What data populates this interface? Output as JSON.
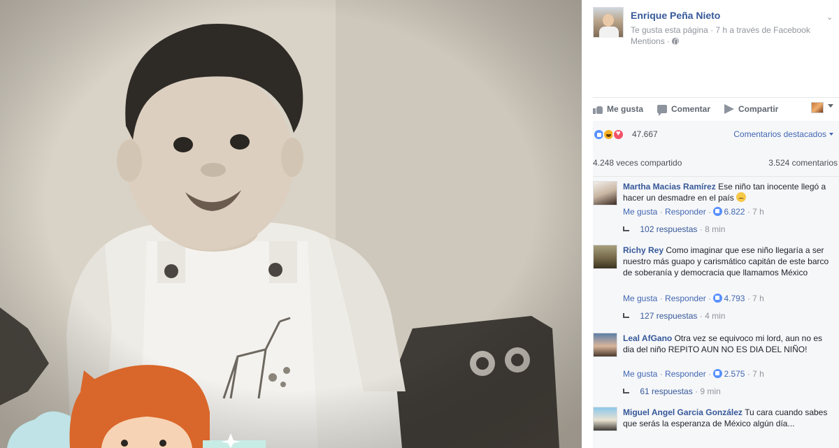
{
  "post": {
    "page_name": "Enrique Peña Nieto",
    "meta_line1": "Te gusta esta página · 7 h a través de Facebook",
    "meta_line2": "Mentions · ",
    "actions": {
      "like": "Me gusta",
      "comment": "Comentar",
      "share": "Compartir"
    },
    "reaction_count": "47.667",
    "top_comments": "Comentarios destacados",
    "shares": "4.248 veces compartido",
    "comments_count": "3.524 comentarios"
  },
  "comments": [
    {
      "author": "Martha Macias Ramírez",
      "text": "Ese niño tan inocente llegó a hacer un desmadre en el país",
      "like": "Me gusta",
      "reply": "Responder",
      "likes": "6.822",
      "time": "7 h",
      "replies": "102 respuestas",
      "replies_time": "8 min"
    },
    {
      "author": "Richy Rey",
      "text": "Como imaginar que ese niño llegaría a ser nuestro más guapo y carismático capitán de este barco de soberanía y democracia que llamamos México",
      "like": "Me gusta",
      "reply": "Responder",
      "likes": "4.793",
      "time": "7 h",
      "replies": "127 respuestas",
      "replies_time": "4 min"
    },
    {
      "author": "Leal AfGano",
      "text": "Otra vez se equivoco mi lord, aun no es dia del niño REPITO AUN NO ES DIA DEL NIÑO!",
      "like": "Me gusta",
      "reply": "Responder",
      "likes": "2.575",
      "time": "7 h",
      "replies": "61 respuestas",
      "replies_time": "9 min"
    },
    {
      "author": "Miguel Angel Garcia González",
      "text": "Tu cara cuando sabes que serás la esperanza de México algún día..."
    }
  ]
}
